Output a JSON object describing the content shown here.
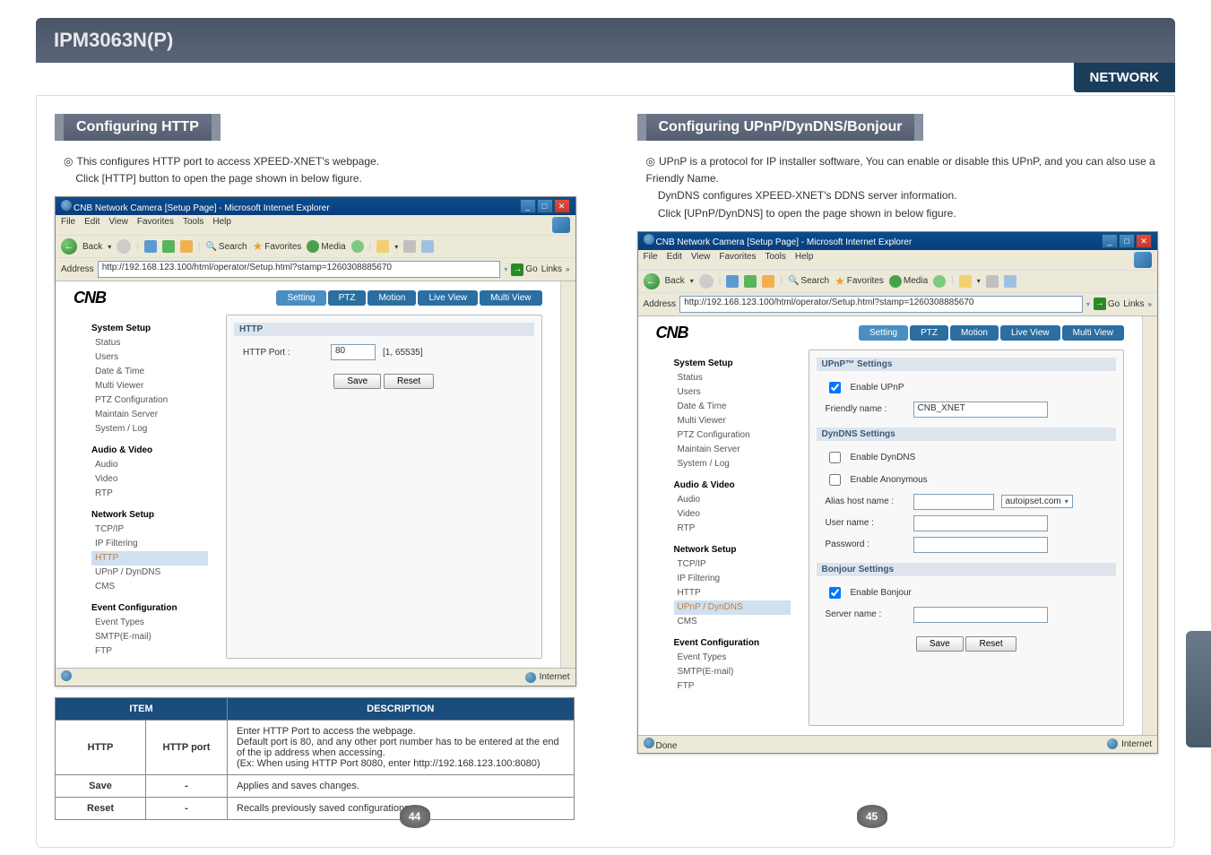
{
  "header": {
    "model": "IPM3063N(P)",
    "category": "NETWORK"
  },
  "left": {
    "section_title": "Configuring HTTP",
    "desc_line1": "This configures HTTP port to access XPEED-XNET's webpage.",
    "desc_line2": "Click [HTTP] button to open the page shown in below figure.",
    "window": {
      "title": "CNB Network Camera [Setup Page] - Microsoft Internet Explorer",
      "menu": {
        "file": "File",
        "edit": "Edit",
        "view": "View",
        "favorites": "Favorites",
        "tools": "Tools",
        "help": "Help"
      },
      "toolbar": {
        "back": "Back",
        "search": "Search",
        "favorites": "Favorites",
        "media": "Media"
      },
      "address_label": "Address",
      "address_value": "http://192.168.123.100/html/operator/Setup.html?stamp=1260308885670",
      "go": "Go",
      "links": "Links",
      "status_left": "",
      "status_right": "Internet"
    },
    "camera_ui": {
      "logo": "CNB",
      "tabs": {
        "setting": "Setting",
        "ptz": "PTZ",
        "motion": "Motion",
        "live": "Live View",
        "multi": "Multi View"
      },
      "sidebar": {
        "g1": "System Setup",
        "g1_items": [
          "Status",
          "Users",
          "Date & Time",
          "Multi Viewer",
          "PTZ Configuration",
          "Maintain Server",
          "System / Log"
        ],
        "g2": "Audio & Video",
        "g2_items": [
          "Audio",
          "Video",
          "RTP"
        ],
        "g3": "Network Setup",
        "g3_items": [
          "TCP/IP",
          "IP Filtering",
          "HTTP",
          "UPnP / DynDNS",
          "CMS"
        ],
        "g4": "Event Configuration",
        "g4_items": [
          "Event Types",
          "SMTP(E-mail)",
          "FTP"
        ]
      },
      "main": {
        "panel_title": "HTTP",
        "field_label": "HTTP Port :",
        "field_value": "80",
        "hint": "[1, 65535]",
        "save": "Save",
        "reset": "Reset"
      }
    },
    "table": {
      "h1": "ITEM",
      "h2": "DESCRIPTION",
      "r1_item": "HTTP",
      "r1_sub": "HTTP port",
      "r1_desc_l1": "Enter HTTP Port to access the webpage.",
      "r1_desc_l2": "Default port is 80, and any other port number has to be entered at the end of the ip address when accessing.",
      "r1_desc_l3": "(Ex: When using HTTP Port 8080, enter http://192.168.123.100:8080)",
      "r2_item": "Save",
      "r2_sub": "-",
      "r2_desc": "Applies and saves changes.",
      "r3_item": "Reset",
      "r3_sub": "-",
      "r3_desc": "Recalls previously saved configurations."
    },
    "page_num": "44"
  },
  "right": {
    "section_title": "Configuring UPnP/DynDNS/Bonjour",
    "desc_line1": "UPnP is a protocol for IP installer software, You can enable or disable this UPnP, and you can also use a Friendly Name.",
    "desc_line2": "DynDNS configures XPEED-XNET's DDNS server information.",
    "desc_line3": "Click [UPnP/DynDNS] to open the page shown in below figure.",
    "window": {
      "title": "CNB Network Camera [Setup Page] - Microsoft Internet Explorer",
      "menu": {
        "file": "File",
        "edit": "Edit",
        "view": "View",
        "favorites": "Favorites",
        "tools": "Tools",
        "help": "Help"
      },
      "toolbar": {
        "back": "Back",
        "search": "Search",
        "favorites": "Favorites",
        "media": "Media"
      },
      "address_label": "Address",
      "address_value": "http://192.168.123.100/html/operator/Setup.html?stamp=1260308885670",
      "go": "Go",
      "links": "Links",
      "status_left": "Done",
      "status_right": "Internet"
    },
    "camera_ui": {
      "logo": "CNB",
      "tabs": {
        "setting": "Setting",
        "ptz": "PTZ",
        "motion": "Motion",
        "live": "Live View",
        "multi": "Multi View"
      },
      "sidebar": {
        "g1": "System Setup",
        "g1_items": [
          "Status",
          "Users",
          "Date & Time",
          "Multi Viewer",
          "PTZ Configuration",
          "Maintain Server",
          "System / Log"
        ],
        "g2": "Audio & Video",
        "g2_items": [
          "Audio",
          "Video",
          "RTP"
        ],
        "g3": "Network Setup",
        "g3_items": [
          "TCP/IP",
          "IP Filtering",
          "HTTP",
          "UPnP / DynDNS",
          "CMS"
        ],
        "g4": "Event Configuration",
        "g4_items": [
          "Event Types",
          "SMTP(E-mail)",
          "FTP"
        ]
      },
      "main": {
        "upnp_header": "UPnP™ Settings",
        "enable_upnp": "Enable UPnP",
        "friendly_label": "Friendly name :",
        "friendly_value": "CNB_XNET",
        "dyndns_header": "DynDNS Settings",
        "enable_dyndns": "Enable DynDNS",
        "enable_anon": "Enable Anonymous",
        "alias_label": "Alias host name :",
        "alias_domain": "autoipset.com",
        "user_label": "User name :",
        "pass_label": "Password :",
        "bonjour_header": "Bonjour Settings",
        "enable_bonjour": "Enable Bonjour",
        "server_label": "Server name :",
        "save": "Save",
        "reset": "Reset"
      }
    },
    "page_num": "45"
  }
}
